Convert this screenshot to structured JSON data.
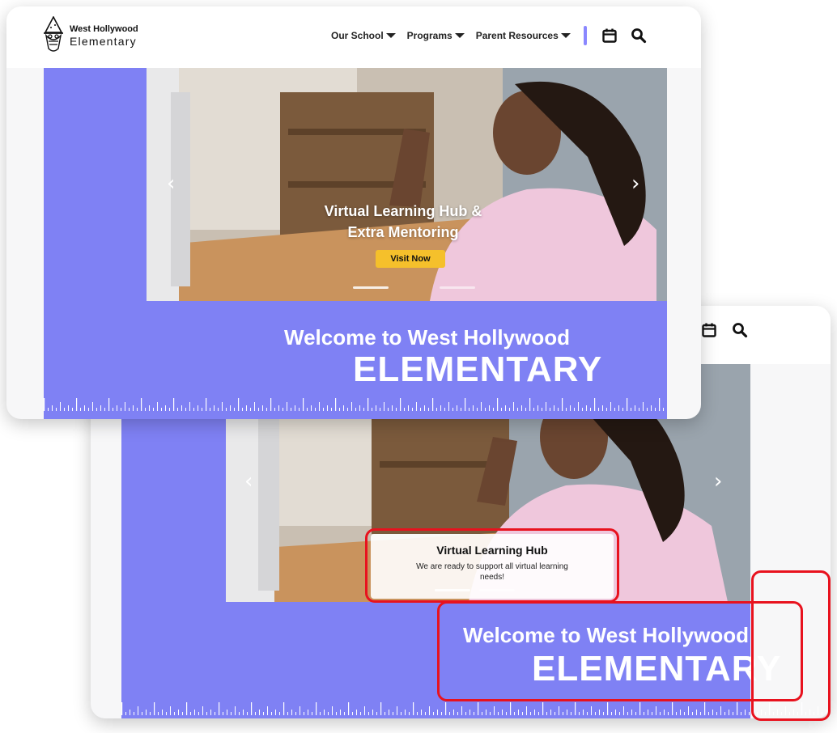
{
  "brand": {
    "line1": "West Hollywood",
    "line2": "Elementary"
  },
  "nav": {
    "items": [
      {
        "label": "Our School"
      },
      {
        "label": "Programs"
      },
      {
        "label": "Parent Resources"
      }
    ],
    "icons": [
      "calendar-icon",
      "search-icon"
    ],
    "separator_color": "#8a87ff"
  },
  "slide": {
    "title_line1": "Virtual Learning Hub &",
    "title_line2": "Extra Mentoring",
    "button_label": "Visit Now",
    "button_color": "#f5c02b",
    "nav_prev": "‹",
    "nav_next": "›"
  },
  "slide_alt": {
    "title": "Virtual Learning Hub",
    "text": "We are ready to support all virtual learning needs!"
  },
  "welcome": {
    "line1": "Welcome to West Hollywood",
    "line2": "ELEMENTARY"
  },
  "colors": {
    "accent": "#7f81f4",
    "highlight": "#e8121e",
    "background": "#f7f7f8"
  }
}
